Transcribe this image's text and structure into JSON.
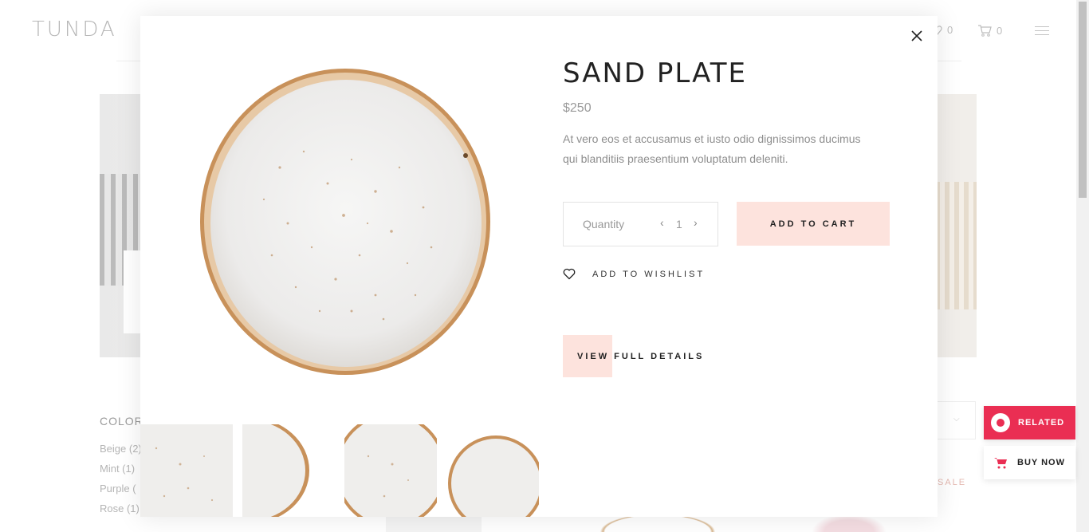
{
  "header": {
    "logo": "TUNDA",
    "wishlist_count": "0",
    "cart_count": "0"
  },
  "sidebar": {
    "title": "COLOR",
    "items": [
      "Beige (2)",
      "Mint (1)",
      "Purple (",
      "Rose (1)"
    ]
  },
  "background": {
    "sale_label": "SALE"
  },
  "floating": {
    "related_label": "RELATED",
    "buy_label": "BUY NOW"
  },
  "product": {
    "title": "SAND PLATE",
    "price": "$250",
    "description": "At vero eos et accusamus et iusto odio dignissimos ducimus qui blanditiis praesentium voluptatum deleniti.",
    "quantity_label": "Quantity",
    "quantity_value": "1",
    "add_to_cart_label": "ADD TO CART",
    "wishlist_label": "ADD TO WISHLIST",
    "view_details_label": "VIEW FULL DETAILS"
  },
  "colors": {
    "accent_pink": "#fde3dd",
    "related_red": "#ea2e53",
    "plate_rim": "#c8915a"
  }
}
